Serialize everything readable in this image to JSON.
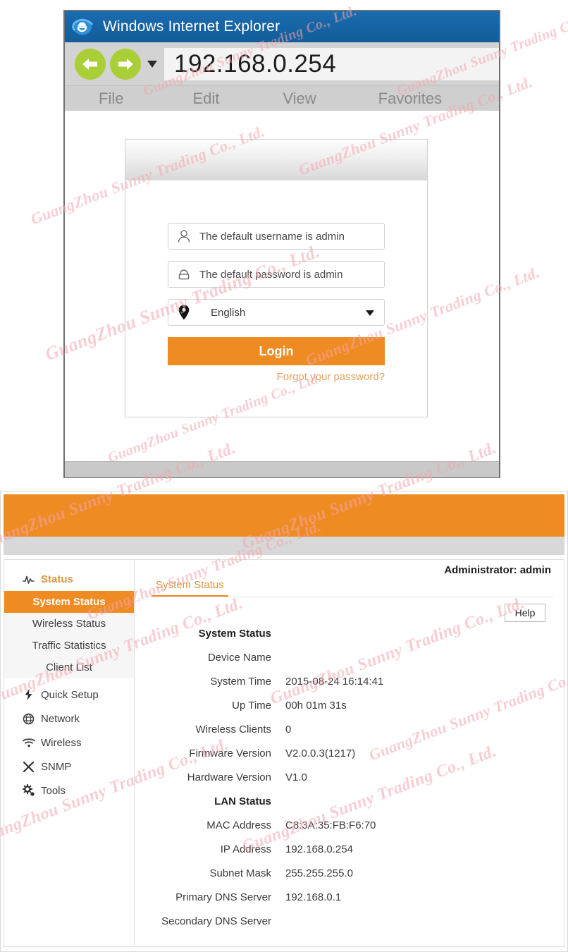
{
  "browser": {
    "title": "Windows Internet Explorer",
    "logo_icon": "ie-logo-icon",
    "back_icon": "back-arrow-icon",
    "forward_icon": "forward-arrow-icon",
    "history_caret_icon": "chevron-down-icon",
    "address": "192.168.0.254",
    "menus": [
      "File",
      "Edit",
      "View",
      "Favorites"
    ]
  },
  "login": {
    "username_icon": "user-icon",
    "username_placeholder": "The default username is admin",
    "password_icon": "lock-icon",
    "password_placeholder": "The default password is admin",
    "language_icon": "location-pin-icon",
    "language_value": "English",
    "language_caret_icon": "caret-down-icon",
    "login_label": "Login",
    "forgot_label": "Forgot your password?"
  },
  "router": {
    "admin_label": "Administrator: admin",
    "tab_label": "System Status",
    "help_label": "Help",
    "sidebar": [
      {
        "label": "Status",
        "icon": "activity-pulse-icon",
        "active": true,
        "children": [
          {
            "label": "System Status",
            "selected": true
          },
          {
            "label": "Wireless Status",
            "selected": false
          },
          {
            "label": "Traffic Statistics",
            "selected": false
          },
          {
            "label": "Client List",
            "selected": false
          }
        ]
      },
      {
        "label": "Quick Setup",
        "icon": "lightning-bolt-icon",
        "active": false,
        "children": []
      },
      {
        "label": "Network",
        "icon": "globe-icon",
        "active": false,
        "children": []
      },
      {
        "label": "Wireless",
        "icon": "wifi-icon",
        "active": false,
        "children": []
      },
      {
        "label": "SNMP",
        "icon": "cross-tools-icon",
        "active": false,
        "children": []
      },
      {
        "label": "Tools",
        "icon": "gears-icon",
        "active": false,
        "children": []
      }
    ],
    "status_rows": [
      {
        "label": "System Status",
        "value": "",
        "section": true
      },
      {
        "label": "Device Name",
        "value": "",
        "section": false
      },
      {
        "label": "System Time",
        "value": "2015-08-24   16:14:41",
        "section": false
      },
      {
        "label": "Up Time",
        "value": "00h 01m 31s",
        "section": false
      },
      {
        "label": "Wireless Clients",
        "value": "0",
        "section": false
      },
      {
        "label": "Firmware Version",
        "value": "V2.0.0.3(1217)",
        "section": false
      },
      {
        "label": "Hardware Version",
        "value": "V1.0",
        "section": false
      },
      {
        "label": "LAN Status",
        "value": "",
        "section": true
      },
      {
        "label": "MAC Address",
        "value": "C8:3A:35:FB:F6:70",
        "section": false
      },
      {
        "label": "IP Address",
        "value": "192.168.0.254",
        "section": false
      },
      {
        "label": "Subnet Mask",
        "value": "255.255.255.0",
        "section": false
      },
      {
        "label": "Primary DNS Server",
        "value": "192.168.0.1",
        "section": false
      },
      {
        "label": "Secondary DNS Server",
        "value": "",
        "section": false
      }
    ]
  },
  "watermark": {
    "text": "GuangZhou Sunny Trading Co., Ltd.",
    "color": "#f3a6ac"
  },
  "colors": {
    "accent_orange": "#ef8b23",
    "ie_blue": "#1464a5",
    "nav_green": "#a9ce36"
  }
}
